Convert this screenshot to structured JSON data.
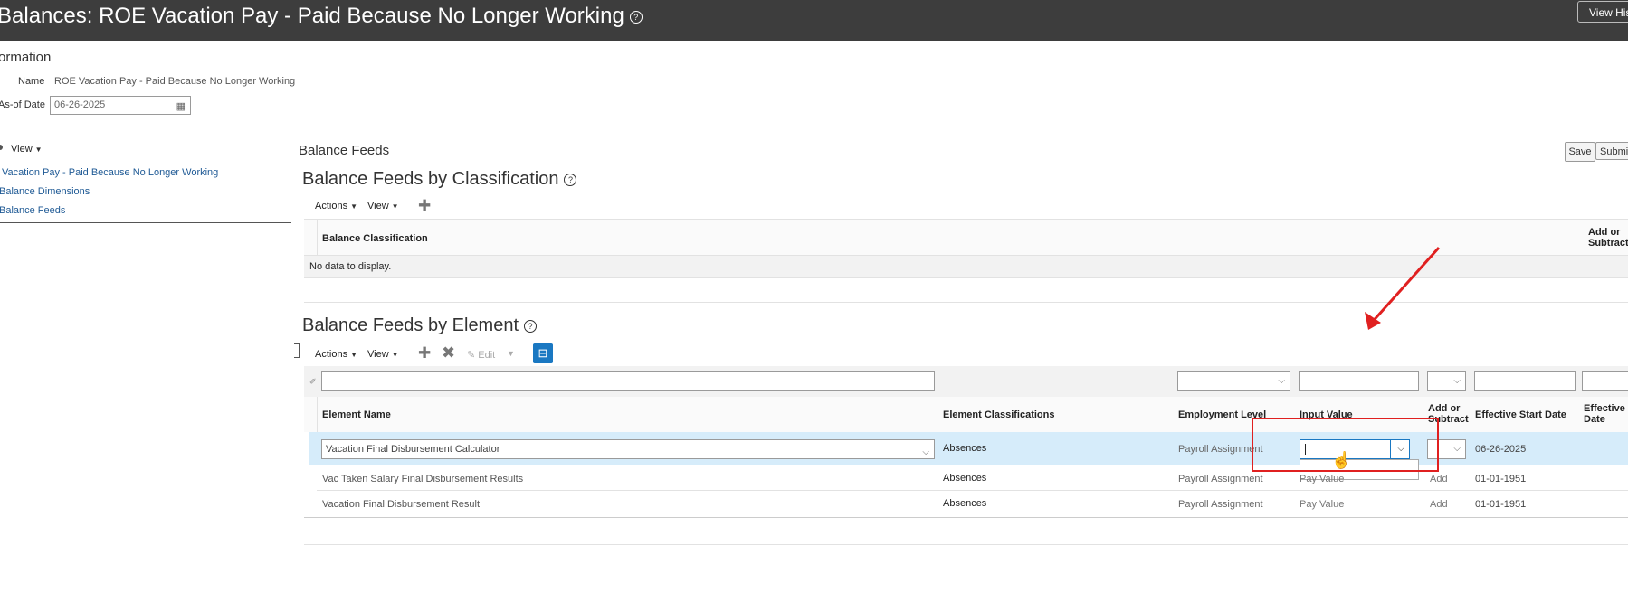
{
  "header": {
    "title": "Balances: ROE Vacation Pay - Paid Because No Longer Working",
    "view_history": "View His"
  },
  "info": {
    "section_title": "ormation",
    "name_label": "Name",
    "name_value": "ROE Vacation Pay - Paid Because No Longer Working",
    "asof_label": "As-of Date",
    "asof_value": "06-26-2025"
  },
  "left_panel": {
    "view_label": "View",
    "items": [
      "Vacation Pay - Paid Because No Longer Working",
      "Balance Dimensions",
      "Balance Feeds"
    ]
  },
  "main": {
    "title": "Balance Feeds",
    "save": "Save",
    "submit": "Submi"
  },
  "by_classification": {
    "title": "Balance Feeds by Classification",
    "actions": "Actions",
    "view": "View",
    "col_classification": "Balance Classification",
    "col_add_or_subtract": "Add or Subtract",
    "empty": "No data to display."
  },
  "by_element": {
    "title": "Balance Feeds by Element",
    "actions": "Actions",
    "view": "View",
    "edit": "Edit",
    "columns": [
      "Element Name",
      "Element Classifications",
      "Employment Level",
      "Input Value",
      "Add or Subtract",
      "Effective Start Date",
      "Effective Date"
    ],
    "rows": [
      {
        "element": "Vacation Final Disbursement Calculator",
        "classification": "Absences",
        "level": "Payroll Assignment",
        "input": "",
        "add": "",
        "start": "06-26-2025"
      },
      {
        "element": "Vac Taken Salary Final Disbursement Results",
        "classification": "Absences",
        "level": "Payroll Assignment",
        "input": "Pay Value",
        "add": "Add",
        "start": "01-01-1951"
      },
      {
        "element": "Vacation Final Disbursement Result",
        "classification": "Absences",
        "level": "Payroll Assignment",
        "input": "Pay Value",
        "add": "Add",
        "start": "01-01-1951"
      }
    ]
  },
  "colors": {
    "title_bar": "#3d3d3d",
    "link": "#1f5a95",
    "selected_row": "#d6ecfa",
    "annotation": "#e02020",
    "accent": "#1a78c2"
  }
}
